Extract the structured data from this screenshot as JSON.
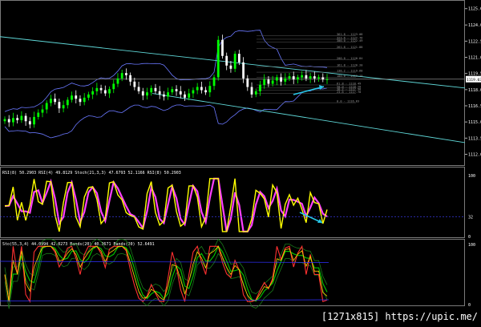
{
  "chart_data": [
    {
      "type": "candlestick",
      "panel": "price",
      "price_axis_ticks": [
        "1125.62",
        "1124.09",
        "1122.58",
        "1121.07",
        "1119.56",
        "1118.05",
        "1116.54",
        "1115.03",
        "1113.52",
        "1112.01"
      ],
      "current_price_tag": "1119.03",
      "fib_labels": [
        "361.8 - 1123.08",
        "323.6 - 1122.76",
        "300.0 - 1122.49",
        "261.8 - 1121.88",
        "200.0 - 1120.84",
        "161.8 - 1120.20",
        "138.2 - 1119.68",
        "100.0 - 1119.19",
        "61.8 - 1118.49",
        "50.0 - 1118.20",
        "38.2 - 1117.98",
        "23.6 - 1117.70",
        "0.0 - 1116.83"
      ],
      "closes": [
        1115.3,
        1115.0,
        1115.4,
        1115.2,
        1115.6,
        1115.1,
        1114.8,
        1115.5,
        1115.9,
        1116.2,
        1116.8,
        1117.2,
        1116.9,
        1116.3,
        1116.6,
        1117.1,
        1117.5,
        1117.2,
        1116.9,
        1117.3,
        1117.6,
        1117.9,
        1118.2,
        1118.0,
        1117.7,
        1118.1,
        1118.6,
        1119.1,
        1119.6,
        1119.4,
        1118.8,
        1118.3,
        1117.9,
        1117.5,
        1117.8,
        1118.2,
        1117.9,
        1117.6,
        1117.4,
        1117.8,
        1118.1,
        1117.9,
        1117.6,
        1117.3,
        1117.7,
        1118.0,
        1118.3,
        1118.0,
        1117.8,
        1118.4,
        1119.2,
        1122.7,
        1121.2,
        1120.3,
        1120.0,
        1121.4,
        1120.6,
        1119.1,
        1118.3,
        1117.6,
        1117.9,
        1118.5,
        1119.0,
        1118.6,
        1118.9,
        1119.2,
        1118.8,
        1119.1,
        1119.3,
        1119.0,
        1119.2,
        1119.4,
        1119.1,
        1119.3,
        1119.1,
        1119.2,
        1119.0,
        1119.03
      ],
      "rsi_axis_ticks": [
        "100",
        "32",
        "0"
      ],
      "rsi_header": "RSI(8) 50.2903  RSI(4) 49.8129  Stoch(21,3,3) 47.6793 52.1166  RSI(8) 50.2903",
      "stoch_axis_ticks": [
        "100",
        "0"
      ],
      "stoch_header": "Sto(55,3,4) 44.0994 42.0273  Bands(20) 40.3671  Bands(20) 52.6491"
    }
  ],
  "watermark": "[1271x815] https://upic.me/",
  "colors": {
    "bg": "#000000",
    "bull": "#00ff00",
    "bear": "#ffffff",
    "channel": "#5fd7d7",
    "bands": "#6a78ff",
    "rsi_fast": "#ffff00",
    "rsi_slow": "#ff40ff",
    "arrow": "#27c7e8",
    "grid": "#5a5a5a"
  }
}
